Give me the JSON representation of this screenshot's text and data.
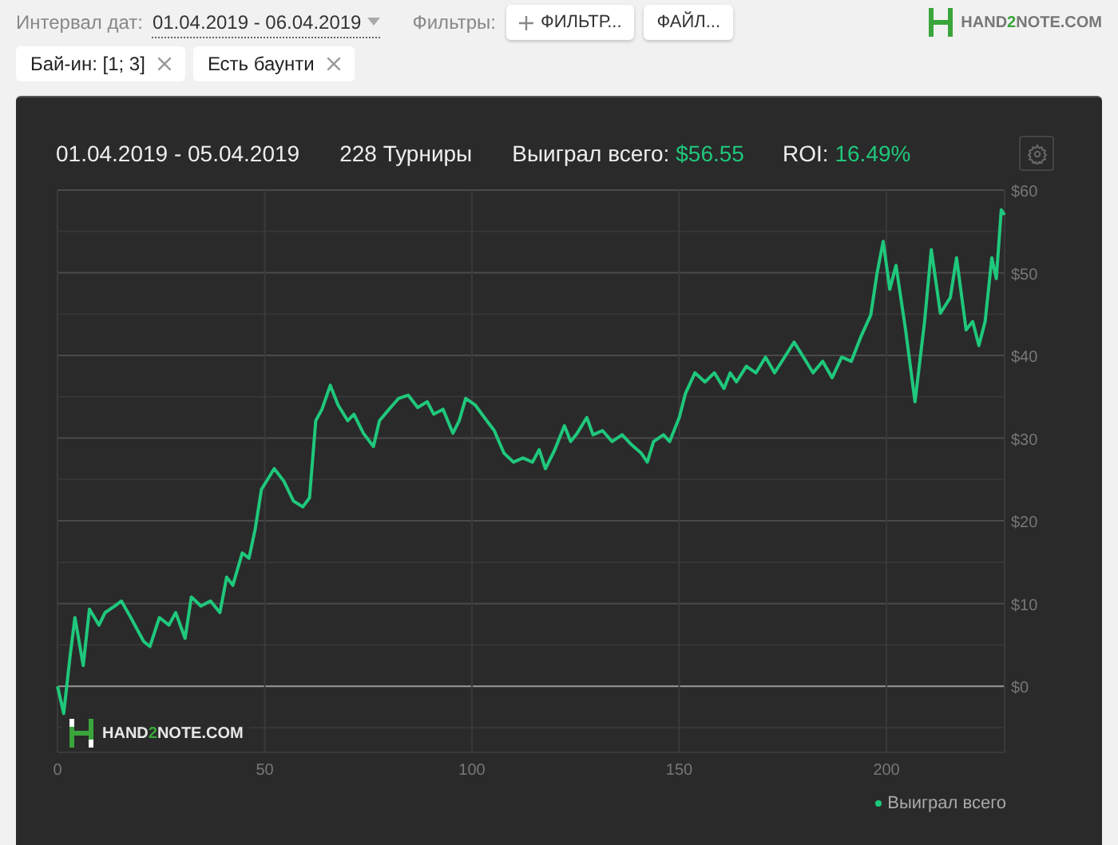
{
  "toolbar": {
    "date_label": "Интервал дат:",
    "date_value": "01.04.2019 - 06.04.2019",
    "filters_label": "Фильтры:",
    "buttons": [
      {
        "label": "ФИЛЬТР...",
        "kind": "add"
      },
      {
        "label": "ФАЙЛ...",
        "kind": "plain"
      }
    ],
    "logo": {
      "prefix": "HAND",
      "accent": "2",
      "suffix": "NOTE.COM"
    }
  },
  "chips": [
    {
      "label": "Бай-ин: [1; 3]"
    },
    {
      "label": "Есть баунти"
    }
  ],
  "summary": {
    "period": "01.04.2019 - 05.04.2019",
    "tournaments": "228 Турниры",
    "won_label": "Выиграл всего:",
    "won_value": "$56.55",
    "roi_label": "ROI:",
    "roi_value": "16.49%"
  },
  "watermark": {
    "prefix": "HAND",
    "accent": "2",
    "suffix": "NOTE.COM"
  },
  "chart_data": {
    "type": "line",
    "x": [
      0,
      1.5,
      3,
      4.2,
      6.2,
      7.7,
      10,
      11.5,
      13.8,
      15.4,
      17.7,
      20.8,
      22.3,
      24.6,
      26.9,
      28.5,
      30.8,
      32.3,
      34.6,
      36.9,
      39.2,
      40.8,
      42.3,
      44.6,
      46.2,
      47.7,
      49.2,
      52.3,
      54.6,
      56.9,
      59.2,
      60.8,
      62.3,
      63.8,
      65.8,
      67.7,
      70,
      71.5,
      73.8,
      76.2,
      77.7,
      80,
      82.3,
      84.6,
      86.9,
      89.2,
      90.8,
      93,
      95.4,
      96.9,
      98.5,
      100.8,
      103,
      105.4,
      107.7,
      110,
      112.3,
      114.6,
      116.2,
      117.7,
      120,
      122.3,
      123.8,
      125.4,
      127.7,
      129.2,
      131.5,
      133.8,
      136.2,
      138.5,
      140.8,
      142.3,
      143.8,
      146.2,
      147.7,
      150,
      151.5,
      153.8,
      156.2,
      158.5,
      160.8,
      162.3,
      163.8,
      166.2,
      168.5,
      170.8,
      173,
      175.4,
      177.7,
      180,
      182.3,
      184.6,
      186.9,
      189.2,
      191.5,
      193.8,
      196.2,
      197.7,
      199.2,
      200.8,
      202.3,
      204.6,
      206.9,
      209.2,
      210.8,
      213,
      215.4,
      216.9,
      219.2,
      220.8,
      222.3,
      223.8,
      225.4,
      226.5,
      227.7,
      228.5
    ],
    "series": [
      {
        "name": "Выиграл всего",
        "color": "#1fc87c",
        "values": [
          0,
          -3.3,
          3.5,
          8.3,
          2.5,
          9.3,
          7.4,
          8.9,
          9.7,
          10.3,
          8.3,
          5.4,
          4.8,
          8.3,
          7.4,
          8.9,
          5.8,
          10.8,
          9.7,
          10.3,
          8.9,
          13.2,
          12.2,
          16.1,
          15.5,
          19,
          23.8,
          26.3,
          24.8,
          22.4,
          21.7,
          22.8,
          32.1,
          33.5,
          36.4,
          34,
          32.1,
          32.9,
          30.6,
          29,
          32.1,
          33.5,
          34.8,
          35.2,
          33.7,
          34.4,
          32.9,
          33.5,
          30.6,
          32.1,
          34.8,
          34,
          32.5,
          30.9,
          28.2,
          27.1,
          27.6,
          27.1,
          28.6,
          26.3,
          28.6,
          31.5,
          29.6,
          30.6,
          32.5,
          30.4,
          30.9,
          29.6,
          30.4,
          29.2,
          28.2,
          27.1,
          29.6,
          30.4,
          29.6,
          32.5,
          35.4,
          37.9,
          36.8,
          37.9,
          36,
          37.9,
          36.8,
          38.7,
          37.9,
          39.8,
          37.9,
          39.8,
          41.6,
          39.8,
          37.9,
          39.3,
          37.3,
          39.8,
          39.3,
          42.2,
          44.9,
          49.9,
          53.8,
          48,
          50.9,
          43.1,
          34.4,
          44.1,
          52.8,
          45.1,
          47,
          51.8,
          43.1,
          44.1,
          41.2,
          44.1,
          51.8,
          49.3,
          57.6,
          57
        ]
      }
    ],
    "grid": true,
    "xlim": [
      0,
      228.5
    ],
    "ylim": [
      -8,
      60
    ],
    "xticks": [
      0,
      50,
      100,
      150,
      200
    ],
    "yticks": [
      {
        "value": 0,
        "label": "$0"
      },
      {
        "value": 10,
        "label": "$10"
      },
      {
        "value": 20,
        "label": "$20"
      },
      {
        "value": 30,
        "label": "$30"
      },
      {
        "value": 40,
        "label": "$40"
      },
      {
        "value": 50,
        "label": "$50"
      },
      {
        "value": 60,
        "label": "$60"
      }
    ]
  }
}
